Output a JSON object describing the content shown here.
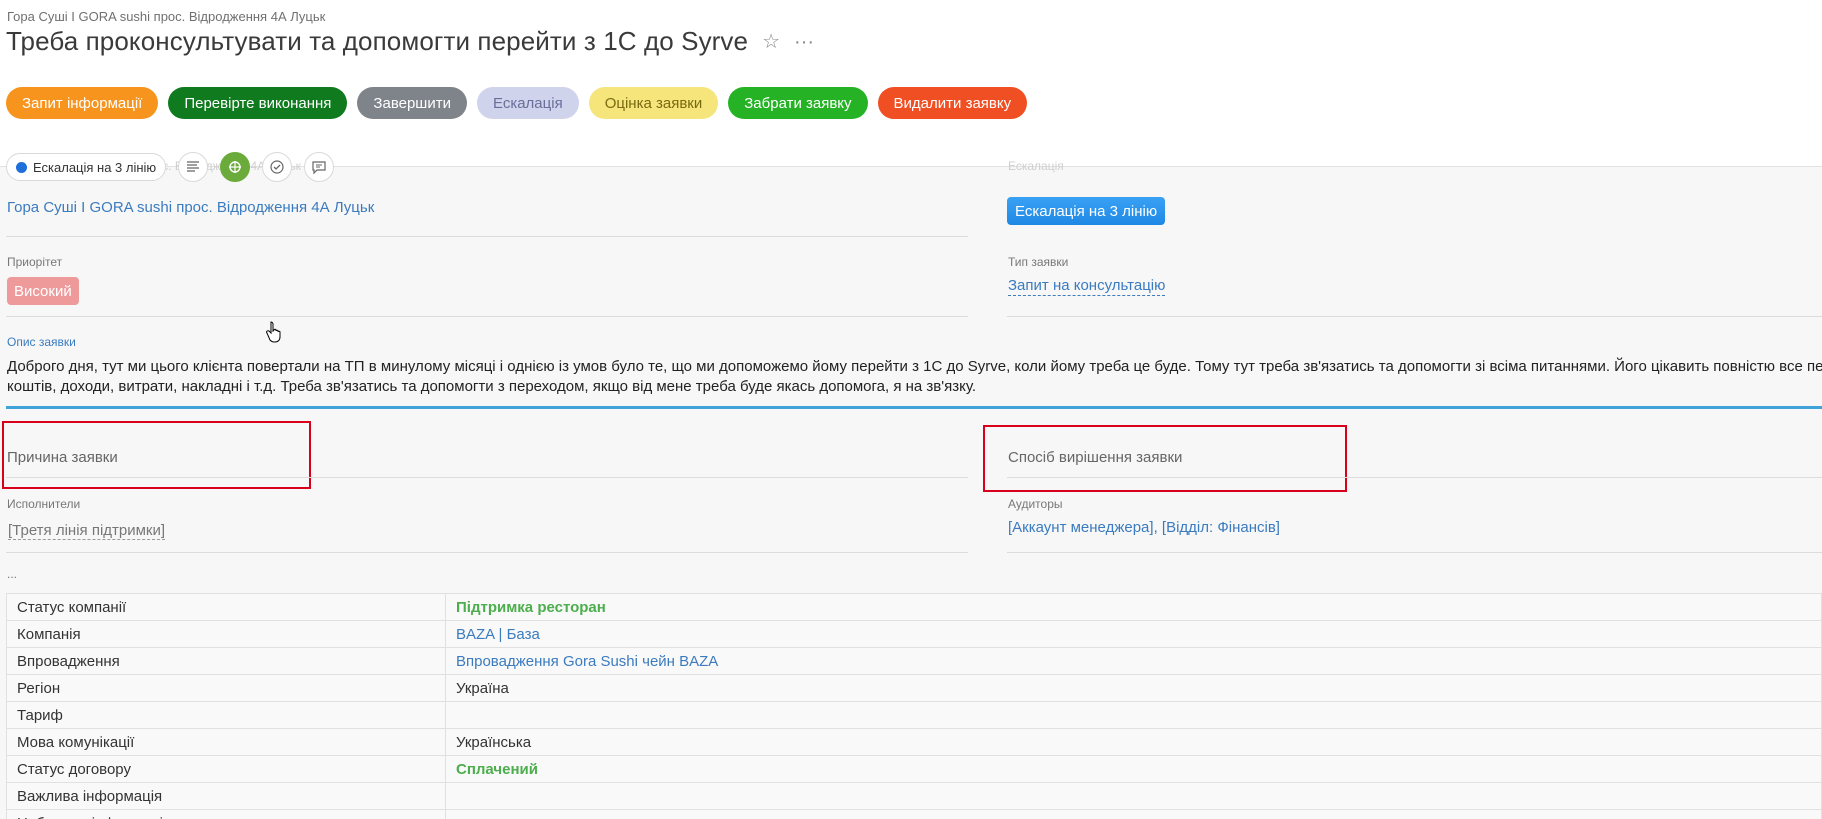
{
  "breadcrumb": "Гора Суші I GORA sushi прос. Відродження 4А Луцьк",
  "title": "Треба проконсультувати та допомогти перейти з 1С до Syrve",
  "actions": [
    {
      "label": "Запит інформації",
      "bg": "#f7941d",
      "fg": "#ffffff"
    },
    {
      "label": "Перевірте виконання",
      "bg": "#0f7a1e",
      "fg": "#ffffff"
    },
    {
      "label": "Завершити",
      "bg": "#7f848b",
      "fg": "#ffffff"
    },
    {
      "label": "Ескалація",
      "bg": "#cfd3ec",
      "fg": "#6a6f9a"
    },
    {
      "label": "Оцінка заявки",
      "bg": "#f5e57a",
      "fg": "#7a6a12"
    },
    {
      "label": "Забрати заявку",
      "bg": "#25b325",
      "fg": "#ffffff"
    },
    {
      "label": "Видалити заявку",
      "bg": "#f04e23",
      "fg": "#ffffff"
    }
  ],
  "toolbar": {
    "status_label": "Ескалація на 3 лінію",
    "icons": [
      "list-icon",
      "gauge-icon",
      "check-circle-icon",
      "comment-icon"
    ]
  },
  "fields": {
    "client_label": "Гора Суші I GORA sushi прос. Відродження 4А Луцьк",
    "client_value": "Гора Суші I GORA sushi прос. Відродження 4А Луцьк",
    "status_label": "Ескалація",
    "status_value": "Ескалація на 3 лінію",
    "priority_label": "Приорітет",
    "priority_value": "Високий",
    "type_label": "Тип заявки",
    "type_value": "Запит на консультацію",
    "desc_label": "Опис заявки",
    "desc_line1": "Доброго дня, тут ми цього клієнта повертали на ТП в минулому місяці і однією із умов було те, що ми допоможемо йому перейти з 1С до Syrve, коли йому треба це буде. Тому тут треба зв'язатись та допомогти зі всіма питаннями. Його цікавить повністю все пер",
    "desc_line2": "коштів, доходи, витрати, накладні і т.д. Треба зв'язатись та допомогти з переходом, якщо від мене треба буде якась допомога, я на зв'язку.",
    "reason_title": "Причина заявки",
    "solution_title": "Спосіб вирішення заявки",
    "executors_label": "Исполнители",
    "executors_value": "[Третя лінія підтримки]",
    "auditors_label": "Аудиторы",
    "auditor1": "[Аккаунт менеджера]",
    "auditor_sep": ", ",
    "auditor2": "[Відділ: Фінансів]",
    "ellipsis": "..."
  },
  "table": [
    {
      "key": "Статус компанії",
      "value": "Підтримка ресторан",
      "style": "green"
    },
    {
      "key": "Компанія",
      "value": "BAZA | База",
      "style": "link"
    },
    {
      "key": "Впровадження",
      "value": "Впровадження Gora Sushi чейн BAZA",
      "style": "link"
    },
    {
      "key": "Регіон",
      "value": "Україна",
      "style": "plain"
    },
    {
      "key": "Тариф",
      "value": "",
      "style": "plain"
    },
    {
      "key": "Мова комунікації",
      "value": "Українська",
      "style": "plain"
    },
    {
      "key": "Статус договору",
      "value": "Сплачений",
      "style": "green"
    },
    {
      "key": "Важлива інформація",
      "value": "",
      "style": "plain",
      "key_style": "red"
    },
    {
      "key": "Небажана інформація",
      "value": "",
      "style": "plain",
      "key_style": "red"
    }
  ]
}
